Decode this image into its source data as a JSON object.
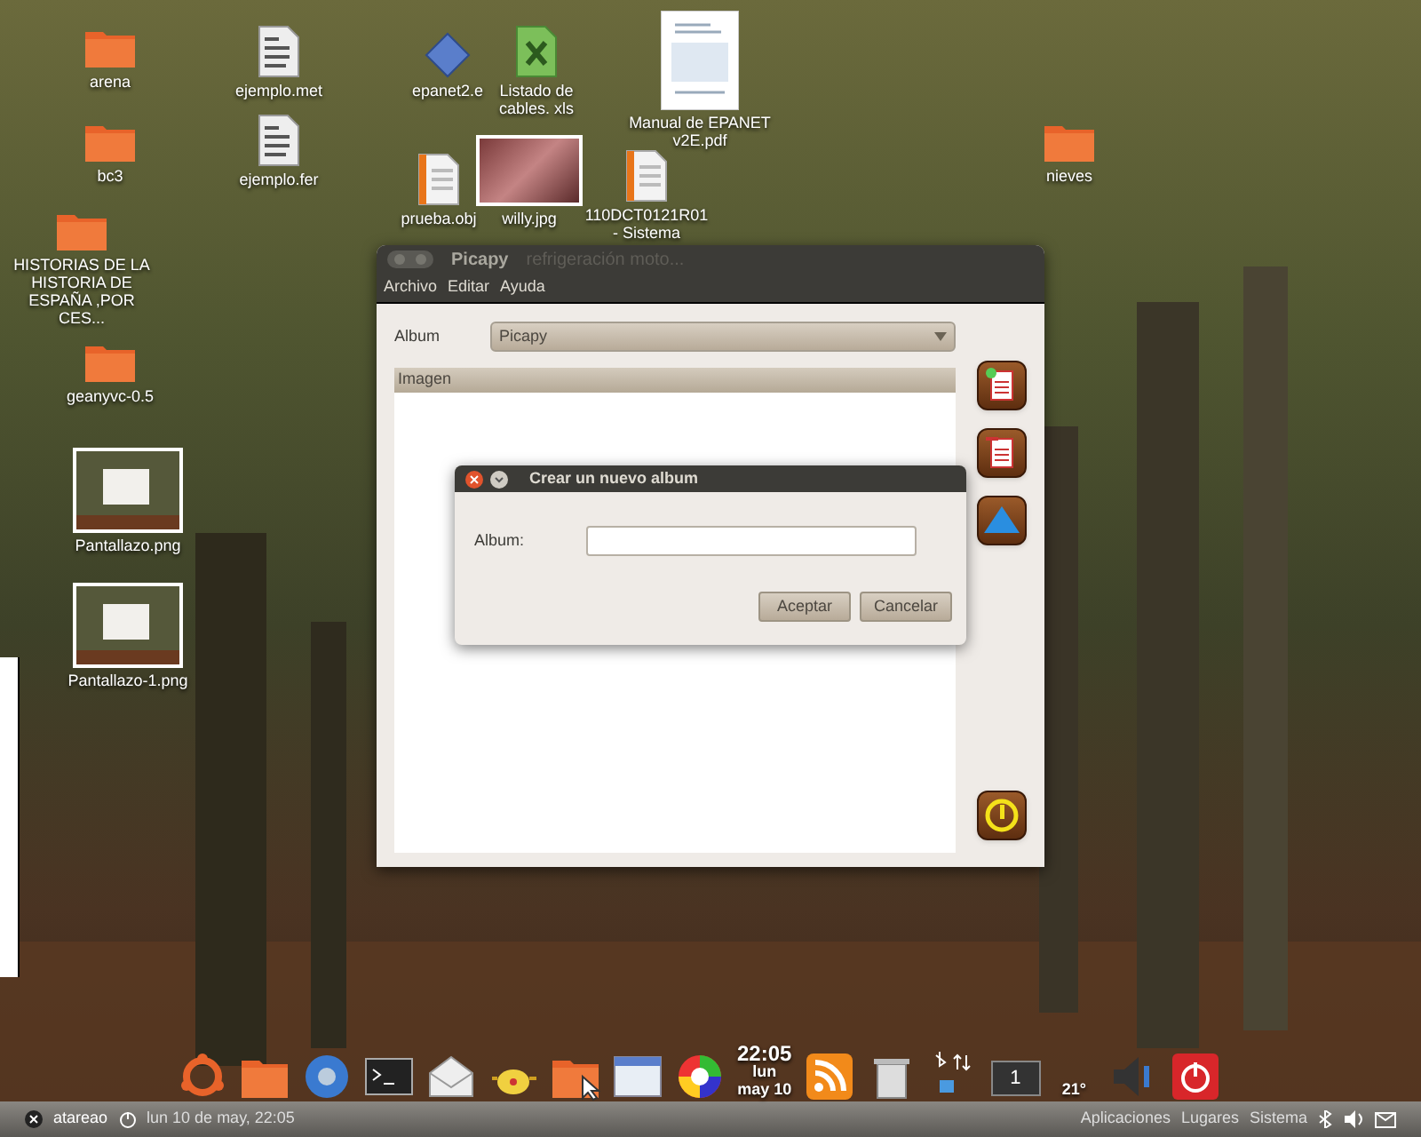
{
  "desktop_icons": [
    {
      "kind": "folder",
      "label": "arena"
    },
    {
      "kind": "folder",
      "label": "bc3"
    },
    {
      "kind": "folder",
      "label": "HISTORIAS DE LA HISTORIA DE ESPAÑA ,POR CES..."
    },
    {
      "kind": "folder",
      "label": "geanyvc-0.5"
    },
    {
      "kind": "screenshot",
      "label": "Pantallazo.png"
    },
    {
      "kind": "screenshot",
      "label": "Pantallazo-1.png"
    },
    {
      "kind": "text",
      "label": "ejemplo.met"
    },
    {
      "kind": "text",
      "label": "ejemplo.fer"
    },
    {
      "kind": "diamond",
      "label": "epanet2.e"
    },
    {
      "kind": "spreadsheet",
      "label": "Listado de cables. xls"
    },
    {
      "kind": "pdf",
      "label": "Manual de EPANET v2E.pdf"
    },
    {
      "kind": "document",
      "label": "prueba.obj"
    },
    {
      "kind": "photo",
      "label": "willy.jpg"
    },
    {
      "kind": "document",
      "label": "110DCT0121R01 - Sistema"
    },
    {
      "kind": "folder",
      "label": "nieves"
    }
  ],
  "window": {
    "title": "Picapy",
    "title_overlap": "refrigeración moto...",
    "menu": [
      "Archivo",
      "Editar",
      "Ayuda"
    ],
    "album_label": "Album",
    "album_value": "Picapy",
    "list_header": "Imagen",
    "side_buttons": [
      {
        "kind": "add-page"
      },
      {
        "kind": "remove-page"
      },
      {
        "kind": "upload"
      },
      {
        "kind": "power"
      }
    ]
  },
  "dialog": {
    "title": "Crear un nuevo album",
    "field_label": "Album:",
    "buttons": [
      "Aceptar",
      "Cancelar"
    ]
  },
  "dock": {
    "items": [
      {
        "kind": "ubuntu"
      },
      {
        "kind": "folder"
      },
      {
        "kind": "browser"
      },
      {
        "kind": "terminal"
      },
      {
        "kind": "mail"
      },
      {
        "kind": "teapot"
      },
      {
        "kind": "folder-cursor"
      },
      {
        "kind": "window"
      },
      {
        "kind": "pinwheel"
      },
      {
        "kind": "clock",
        "lines": [
          "22:05",
          "lun",
          "may 10"
        ]
      },
      {
        "kind": "rss"
      },
      {
        "kind": "trash"
      },
      {
        "kind": "indicators"
      },
      {
        "kind": "workspace",
        "text": "1"
      },
      {
        "kind": "weather",
        "text": "21°"
      },
      {
        "kind": "speaker"
      },
      {
        "kind": "power"
      }
    ]
  },
  "panel": {
    "user": "atareao",
    "datetime": "lun 10 de may, 22:05",
    "menus": [
      "Aplicaciones",
      "Lugares",
      "Sistema"
    ]
  }
}
